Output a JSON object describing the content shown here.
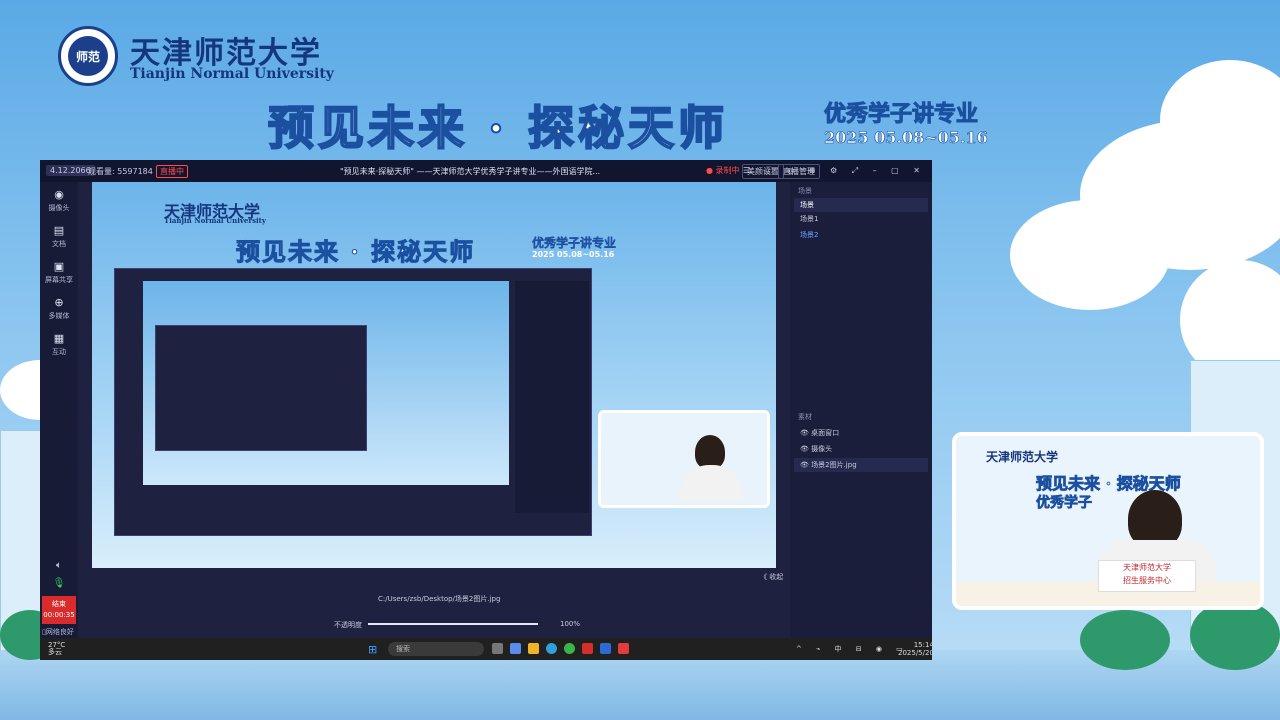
{
  "header": {
    "logo_text": "师范",
    "university_cn": "天津师范大学",
    "university_en": "Tianjin Normal University",
    "main_title": "预见未来 · 探秘天师",
    "subtitle": "优秀学子讲专业",
    "date_range": "2025 05.08~05.16"
  },
  "window": {
    "version": "4.12.2066",
    "room_label": "观看量: 5597184",
    "live_badge": "直播中",
    "title": "\"预见未来·探秘天师\" ——天津师范大学优秀学子讲专业——外国语学院...",
    "record_label": "● 录制中",
    "btn_beauty": "美颜设置",
    "btn_manage": "直播管理",
    "window_icons": "☰ ⓘ ◎ ⊕ ⚙ ⤢ – ▢ ✕"
  },
  "leftbar": {
    "items": [
      {
        "icon": "◉",
        "label": "摄像头"
      },
      {
        "icon": "▤",
        "label": "文档"
      },
      {
        "icon": "▣",
        "label": "屏幕共享"
      },
      {
        "icon": "⊕",
        "label": "多媒体"
      },
      {
        "icon": "▦",
        "label": "互动"
      }
    ],
    "end_label": "结束",
    "end_time": "00:00:35",
    "bottom_label": "▯网络良好"
  },
  "preview": {
    "cn": "天津师范大学",
    "en": "Tianjin Normal University",
    "main": "预见未来 · 探秘天师",
    "sub": "优秀学子讲专业",
    "date": "2025 05.08~05.16"
  },
  "scene_panel": {
    "header": "场景",
    "active": "场景",
    "scenes": [
      "场景1",
      "场景2"
    ],
    "material_header": "素材",
    "materials": [
      "桌面窗口",
      "摄像头",
      "场景2图片.jpg"
    ]
  },
  "right_tabs": [
    "降噪",
    "画质",
    "设置"
  ],
  "bottom": {
    "collapse": "《 收起",
    "file_path": "C:/Users/zsb/Desktop/场景2图片.jpg",
    "progress_label": "不透明度",
    "progress_percent": 100,
    "progress_value": "100%"
  },
  "taskbar": {
    "weather_temp": "27°C",
    "weather_desc": "多云",
    "start_icon": "⊞",
    "search_placeholder": "搜索",
    "tray": "^ ⌁ 中 ⊟ ◉ ▭",
    "time": "15:14",
    "date": "2025/5/20"
  },
  "camera": {
    "cn": "天津师范大学",
    "main": "预见未来 · 探秘天师",
    "sub": "优秀学子",
    "sign_cn": "天津师范大学",
    "sign_sub": "招生服务中心"
  },
  "colors": {
    "brand_blue": "#15357d",
    "window_bg": "#1e2140",
    "end_red": "#d92b2b"
  }
}
